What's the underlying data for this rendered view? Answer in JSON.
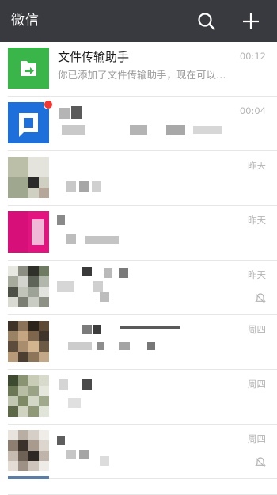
{
  "header": {
    "title": "微信",
    "search_icon": "search-icon",
    "add_icon": "plus-icon",
    "background": "#393a3f"
  },
  "chats": [
    {
      "name": "文件传输助手",
      "preview": "你已添加了文件传输助手，现在可以…",
      "time": "00:12",
      "avatar_color": "#3ab54a",
      "avatar_icon": "file-transfer-icon"
    },
    {
      "name": "",
      "preview": "",
      "time": "00:04",
      "unread": true,
      "avatar_color": "#1e6fd9"
    },
    {
      "name": "",
      "preview": "",
      "time": "昨天"
    },
    {
      "name": "",
      "preview": "",
      "time": "昨天",
      "avatar_color": "#e3147f"
    },
    {
      "name": "",
      "preview": "",
      "time": "昨天",
      "muted": true
    },
    {
      "name": "",
      "preview": "",
      "time": "周四"
    },
    {
      "name": "",
      "preview": "",
      "time": "周四"
    },
    {
      "name": "",
      "preview": "",
      "time": "周四",
      "muted": true
    }
  ]
}
